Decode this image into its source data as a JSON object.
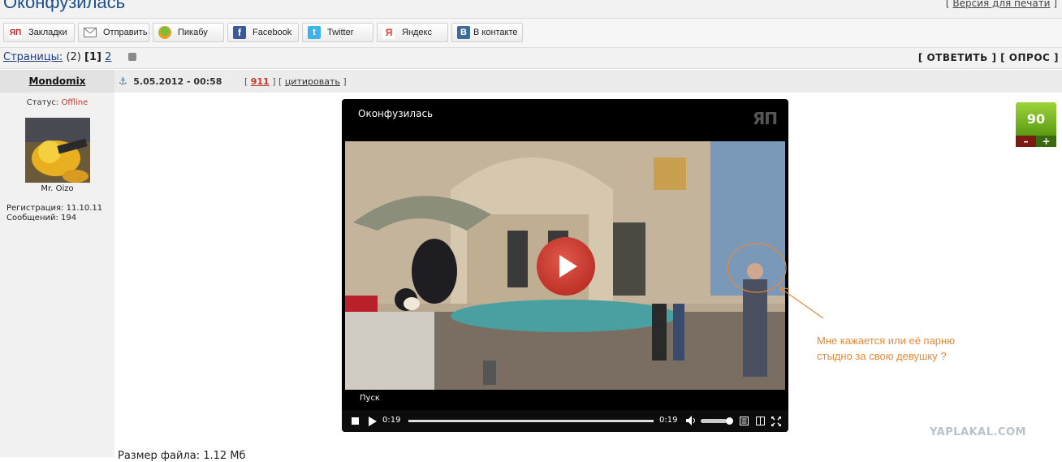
{
  "header": {
    "title": "Оконфузилась",
    "print_bracket_open": "[",
    "print_link": "Версия для печати",
    "print_bracket_close": "]"
  },
  "share": {
    "buttons": [
      {
        "label": "Закладки",
        "icon": "yap-icon",
        "color": "#cc1f1f"
      },
      {
        "label": "Отправить",
        "icon": "envelope-icon",
        "color": "#6e6e6e"
      },
      {
        "label": "Пикабу",
        "icon": "pikabu-icon",
        "color": "#e8a020"
      },
      {
        "label": "Facebook",
        "icon": "facebook-icon",
        "color": "#3b5998"
      },
      {
        "label": "Twitter",
        "icon": "twitter-icon",
        "color": "#3cb4e8"
      },
      {
        "label": "Яндекс",
        "icon": "yandex-icon",
        "color": "#e03a2e"
      },
      {
        "label": "В контакте",
        "icon": "vk-icon",
        "color": "#3d6a98"
      }
    ]
  },
  "pagination": {
    "label": "Страницы:",
    "total": "(2)",
    "current": "[1]",
    "next": "2"
  },
  "actions": {
    "reply": "[ ОТВЕТИТЬ ]",
    "poll": "[ ОПРОС ]"
  },
  "post": {
    "author": "Mondomix",
    "date": "5.05.2012 - 00:58",
    "post_number": "911",
    "quote": "цитировать",
    "status_label": "Статус:",
    "status_value": "Offline",
    "user_title": "Mr. Oizo",
    "registration": "Регистрация: 11.10.11",
    "messages": "Сообщений: 194",
    "rating": "90",
    "rating_minus": "–",
    "rating_plus": "+",
    "annotation_line1": "Мне кажается или её парню",
    "annotation_line2": "стыдно за свою девушку ?",
    "file_size": "Размер файла: 1.12 Мб"
  },
  "video": {
    "title": "Оконфузилась",
    "logo": "ЯП",
    "start_label": "Пуск",
    "time_elapsed": "0:19",
    "time_total": "0:19",
    "progress": 1.0,
    "volume": 0.8
  },
  "watermark": "YAPLAKAL.COM",
  "colors": {
    "title_blue": "#1a4f8a",
    "status_offline": "#c0392b",
    "post_number_red": "#c0392b",
    "annotation_orange": "#e6893a",
    "rating_green": "#7bbf24"
  }
}
